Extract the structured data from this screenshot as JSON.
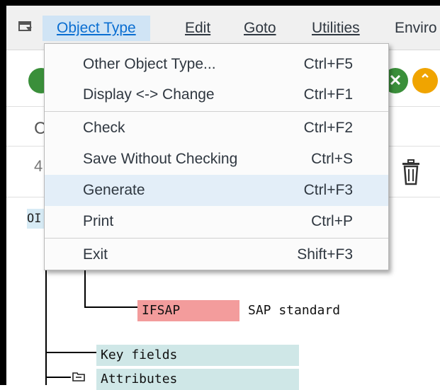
{
  "menubar": {
    "items": [
      {
        "label": "Object Type",
        "active": true
      },
      {
        "label": "Edit"
      },
      {
        "label": "Goto"
      },
      {
        "label": "Utilities"
      },
      {
        "label": "Enviro"
      }
    ]
  },
  "object_type_menu": {
    "items": [
      {
        "label": "Other Object Type...",
        "shortcut": "Ctrl+F5"
      },
      {
        "label": "Display <-> Change",
        "shortcut": "Ctrl+F1"
      },
      {
        "label": "Check",
        "shortcut": "Ctrl+F2"
      },
      {
        "label": "Save Without Checking",
        "shortcut": "Ctrl+S"
      },
      {
        "label": "Generate",
        "shortcut": "Ctrl+F3",
        "highlighted": true
      },
      {
        "label": "Print",
        "shortcut": "Ctrl+P"
      },
      {
        "label": "Exit",
        "shortcut": "Shift+F3"
      }
    ]
  },
  "background": {
    "partial_c": "C",
    "partial_4": "4",
    "node_left": "OI"
  },
  "tree": {
    "ifsap": {
      "name": "IFSAP",
      "desc": "SAP standard"
    },
    "key_fields": "Key fields",
    "attributes": "Attributes"
  },
  "colors": {
    "menu_active_bg": "#d0e4f5",
    "menu_active_text": "#0a6ed1",
    "highlight_row": "#e3eef8",
    "node_teal": "#cfe7e7",
    "node_red": "#f39c9c",
    "ok_green": "#3a8f3a",
    "up_orange": "#f0a400"
  }
}
